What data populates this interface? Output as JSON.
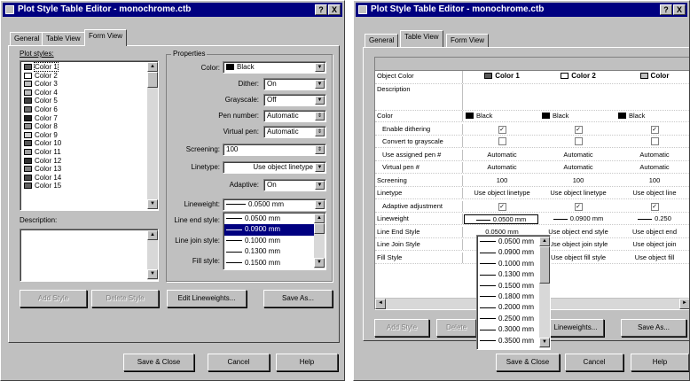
{
  "left": {
    "title": "Plot Style Table Editor - monochrome.ctb",
    "help_btn": "?",
    "close_btn": "X",
    "tabs": [
      "General",
      "Table View",
      "Form View"
    ],
    "plot_styles_label": "Plot styles:",
    "plot_styles": [
      {
        "name": "Color 1",
        "color": "#5a5a5a"
      },
      {
        "name": "Color 2",
        "color": "#ffffff"
      },
      {
        "name": "Color 3",
        "color": "#c0c0c0"
      },
      {
        "name": "Color 4",
        "color": "#c0c0c0"
      },
      {
        "name": "Color 5",
        "color": "#404040"
      },
      {
        "name": "Color 6",
        "color": "#707070"
      },
      {
        "name": "Color 7",
        "color": "#202020"
      },
      {
        "name": "Color 8",
        "color": "#909090"
      },
      {
        "name": "Color 9",
        "color": "#d0d0d0"
      },
      {
        "name": "Color 10",
        "color": "#555555"
      },
      {
        "name": "Color 11",
        "color": "#a0a0a0"
      },
      {
        "name": "Color 12",
        "color": "#303030"
      },
      {
        "name": "Color 13",
        "color": "#808080"
      },
      {
        "name": "Color 14",
        "color": "#484848"
      },
      {
        "name": "Color 15",
        "color": "#606060"
      }
    ],
    "description_label": "Description:",
    "properties_label": "Properties",
    "props": {
      "color_label": "Color:",
      "color_value": "Black",
      "dither_label": "Dither:",
      "dither_value": "On",
      "grayscale_label": "Grayscale:",
      "grayscale_value": "Off",
      "pen_label": "Pen number:",
      "pen_value": "Automatic",
      "vpen_label": "Virtual pen:",
      "vpen_value": "Automatic",
      "screening_label": "Screening:",
      "screening_value": "100",
      "linetype_label": "Linetype:",
      "linetype_value": "Use object linetype",
      "adaptive_label": "Adaptive:",
      "adaptive_value": "On",
      "lineweight_label": "Lineweight:",
      "lineweight_value": "0.0500 mm",
      "lineend_label": "Line end style:",
      "linejoin_label": "Line join style:",
      "fill_label": "Fill style:"
    },
    "lw_list": [
      "0.0500 mm",
      "0.0900 mm",
      "0.1000 mm",
      "0.1300 mm",
      "0.1500 mm"
    ],
    "lw_selected": "0.0900 mm",
    "add_style": "Add Style",
    "delete_style": "Delete Style",
    "edit_lineweights": "Edit Lineweights...",
    "save_as": "Save As...",
    "save_close": "Save & Close",
    "cancel": "Cancel",
    "help": "Help"
  },
  "right": {
    "title": "Plot Style Table Editor - monochrome.ctb",
    "help_btn": "?",
    "close_btn": "X",
    "tabs": [
      "General",
      "Table View",
      "Form View"
    ],
    "columns": [
      {
        "name": "Color 1",
        "swatch": "#5a5a5a"
      },
      {
        "name": "Color 2",
        "swatch": "#ffffff"
      },
      {
        "name": "Color",
        "swatch": "#c0c0c0"
      }
    ],
    "rows": [
      {
        "label": "Object Color",
        "indent": false
      },
      {
        "label": "Description",
        "indent": false
      },
      {
        "label": "Color",
        "indent": false,
        "values": [
          "Black",
          "Black",
          "Black"
        ]
      },
      {
        "label": "Enable dithering",
        "indent": true,
        "values": [
          "check",
          "check",
          "check"
        ]
      },
      {
        "label": "Convert to grayscale",
        "indent": true,
        "values": [
          "empty",
          "empty",
          "empty"
        ]
      },
      {
        "label": "Use assigned pen #",
        "indent": true,
        "values": [
          "Automatic",
          "Automatic",
          "Automatic"
        ]
      },
      {
        "label": "Virtual pen #",
        "indent": true,
        "values": [
          "Automatic",
          "Automatic",
          "Automatic"
        ]
      },
      {
        "label": "Screening",
        "indent": false,
        "values": [
          "100",
          "100",
          "100"
        ]
      },
      {
        "label": "Linetype",
        "indent": false,
        "values": [
          "Use object linetype",
          "Use object linetype",
          "Use object line"
        ]
      },
      {
        "label": "Adaptive adjustment",
        "indent": true,
        "values": [
          "check",
          "check",
          "check"
        ]
      },
      {
        "label": "Lineweight",
        "indent": false,
        "values": [
          "0.0500 mm",
          "0.0900 mm",
          "0.250"
        ]
      },
      {
        "label": "Line End Style",
        "indent": false,
        "values": [
          "0.0500 mm",
          "Use object end style",
          "Use object end"
        ]
      },
      {
        "label": "Line Join Style",
        "indent": false,
        "values": [
          "",
          "Use object join style",
          "Use object join"
        ]
      },
      {
        "label": "Fill Style",
        "indent": false,
        "values": [
          "",
          "Use object fill style",
          "Use object fill"
        ]
      }
    ],
    "lw_dropdown": [
      "0.0500 mm",
      "0.0900 mm",
      "0.1000 mm",
      "0.1300 mm",
      "0.1500 mm",
      "0.1800 mm",
      "0.2000 mm",
      "0.2500 mm",
      "0.3000 mm",
      "0.3500 mm"
    ],
    "add_style": "Add Style",
    "delete_style": "Delete",
    "edit_lineweights": "Lineweights...",
    "save_as": "Save As...",
    "save_close": "Save & Close",
    "cancel": "Cancel",
    "help": "Help"
  }
}
